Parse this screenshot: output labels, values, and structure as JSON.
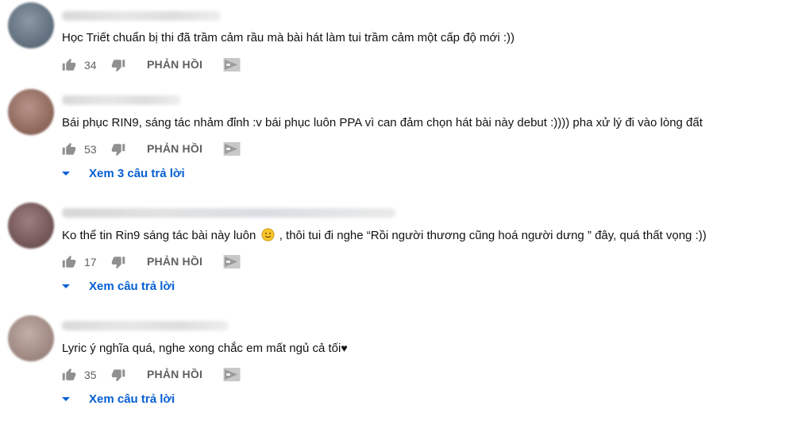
{
  "comments": [
    {
      "text": "Học Triết chuẩn bị thi đã trầm cảm rầu mà bài hát làm tui trầm cảm một cấp độ mới :))",
      "likes": "34",
      "reply_label": "PHẢN HỒI",
      "avatar_color": "#6b7a88"
    },
    {
      "text": "Bái phục RIN9, sáng tác nhảm đỉnh :v bái phục luôn PPA vì can đảm chọn hát bài này debut :)))) pha xử lý đi vào lòng đất",
      "likes": "53",
      "reply_label": "PHẢN HỒI",
      "view_replies": "Xem 3 câu trả lời",
      "avatar_color": "#a07a6e"
    },
    {
      "text_before": "Ko thể tin Rin9 sáng tác bài này luôn",
      "text_after": ", thôi tui đi nghe “Rồi người thương cũng hoá người dưng ” đây, quá thất vọng :))",
      "likes": "17",
      "reply_label": "PHẢN HỒI",
      "view_replies": "Xem câu trả lời",
      "avatar_color": "#8a6c6c"
    },
    {
      "text": "Lyric ý nghĩa quá, nghe xong chắc em mất ngủ cả tối",
      "heart": "♥",
      "likes": "35",
      "reply_label": "PHẢN HỒI",
      "view_replies": "Xem câu trả lời",
      "avatar_color": "#b09a94"
    }
  ],
  "icons": {
    "like": "thumb-up-icon",
    "dislike": "thumb-down-icon",
    "creator": "creator-heart-badge-icon",
    "caret": "caret-down-icon",
    "emoji": "slightly-smiling-face-emoji"
  },
  "colors": {
    "link_blue": "#065fd4",
    "secondary_text": "#606060",
    "icon_gray": "#909090"
  }
}
